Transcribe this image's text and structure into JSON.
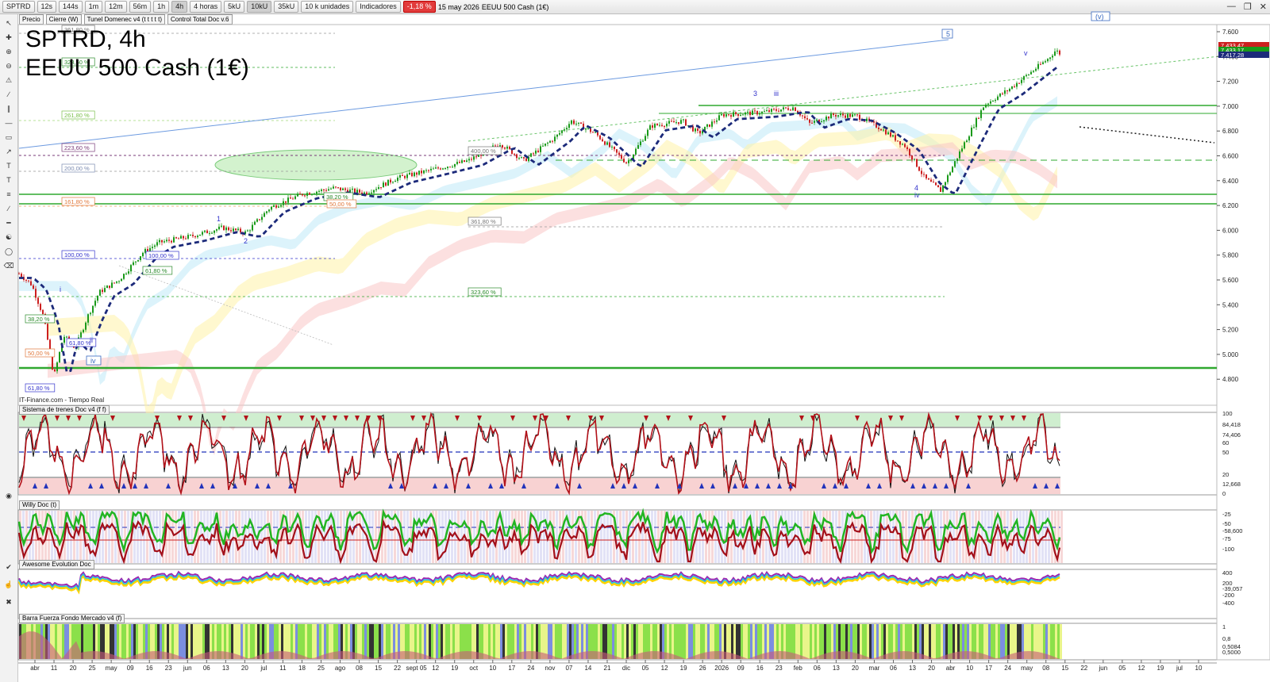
{
  "toolbar": {
    "symbol": "SPTRD",
    "intervals": [
      "12s",
      "144s",
      "1m",
      "12m",
      "56m",
      "1h",
      "4h",
      "4 horas",
      "5kU",
      "10kU",
      "35kU",
      "10 k unidades"
    ],
    "active_interval": "4h",
    "indicators_label": "Indicadores",
    "change_badge": "-1,18 %",
    "date_label": "15 may 2026",
    "instrument_label": "EEUU 500 Cash (1€)"
  },
  "legend": [
    "Precio",
    "Cierre (W)",
    "Tunel Domenec v4 (t t t t t)",
    "Control Total Doc v.6"
  ],
  "title": {
    "line1": "SPTRD, 4h",
    "line2": "EEUU 500 Cash (1€)"
  },
  "credit": "IT-Finance.com - Tiempo Real",
  "panels": {
    "p1": "Sistema de trenes Doc v4 (f f)",
    "p2": "Willy Doc (t)",
    "p3": "Awesome Evolution Doc",
    "p4": "Barra Fuerza Fondo Mercado v4 (f)"
  },
  "price_axis": {
    "ticks": [
      "7.600",
      "7.400",
      "7.200",
      "7.000",
      "6.800",
      "6.600",
      "6.400",
      "6.200",
      "6.000",
      "5.800",
      "5.600",
      "5.400",
      "5.200",
      "5.000",
      "4.800"
    ],
    "badges": [
      "7.433,47",
      "7.433,17",
      "7.417,28"
    ]
  },
  "panel_axes": {
    "p1": [
      "100",
      "84,418",
      "74,406",
      "60",
      "50",
      "20",
      "12,668",
      "0"
    ],
    "p2": [
      "-25",
      "-50",
      "-58,600",
      "-75",
      "-100"
    ],
    "p3": [
      "400",
      "200",
      "-39,057",
      "-200",
      "-400"
    ],
    "p4": [
      "1",
      "0,8",
      "0,5084",
      "0,5000"
    ]
  },
  "time_axis": [
    "abr",
    "11",
    "20",
    "25",
    "may",
    "09",
    "16",
    "23",
    "jun",
    "06",
    "13",
    "20",
    "jul",
    "11",
    "18",
    "25",
    "ago",
    "08",
    "15",
    "22",
    "sept 05",
    "12",
    "19",
    "oct",
    "10",
    "17",
    "24",
    "nov",
    "07",
    "14",
    "21",
    "dic",
    "05",
    "12",
    "19",
    "26",
    "2026",
    "09",
    "16",
    "23",
    "feb",
    "06",
    "13",
    "20",
    "mar",
    "06",
    "13",
    "20",
    "abr",
    "10",
    "17",
    "24",
    "may",
    "08",
    "15",
    "22",
    "jun",
    "05",
    "12",
    "19",
    "jul",
    "10"
  ],
  "fib_labels": [
    "361,80 %",
    "323,60 %",
    "261,80 %",
    "223,60 %",
    "200,00 %",
    "161,80 %",
    "100,00 %",
    "38,20 %",
    "50,00 %",
    "61,80 %",
    "61,80 %",
    "400,00 %",
    "361,80 %",
    "323,60 %",
    "38,20 %",
    "50,00 %",
    "61,80 %",
    "100,00 %"
  ],
  "wave_labels": [
    "5",
    "3",
    "iii",
    "1",
    "2",
    "i",
    "ii",
    "iv",
    "4",
    "iv",
    "v",
    "(v)"
  ]
}
